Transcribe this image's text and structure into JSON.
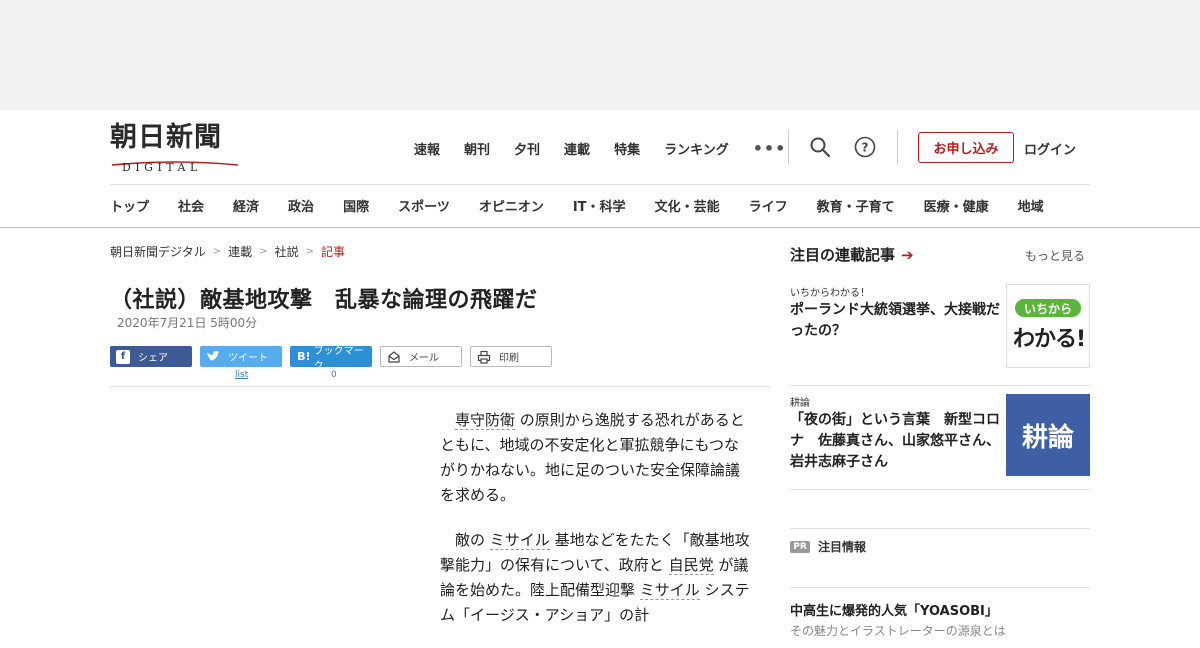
{
  "header": {
    "logo_kanji": "朝日新聞",
    "logo_sub": "DIGITAL",
    "top_nav": [
      "速報",
      "朝刊",
      "夕刊",
      "連載",
      "特集",
      "ランキング"
    ],
    "more_icon": "ellipsis-icon",
    "search_icon": "search-icon",
    "help_icon": "help-icon",
    "apply_label": "お申し込み",
    "login_label": "ログイン",
    "category_nav": [
      "トップ",
      "社会",
      "経済",
      "政治",
      "国際",
      "スポーツ",
      "オピニオン",
      "IT・科学",
      "文化・芸能",
      "ライフ",
      "教育・子育て",
      "医療・健康",
      "地域"
    ]
  },
  "breadcrumb": [
    "朝日新聞デジタル",
    "連載",
    "社説",
    "記事"
  ],
  "article": {
    "title": "（社説）敵基地攻撃　乱暴な論理の飛躍だ",
    "date": "2020年7月21日 5時00分",
    "share": {
      "facebook": "シェア",
      "twitter": "ツイート",
      "twitter_count": "list",
      "hatena": "ブックマーク",
      "hatena_count": "0",
      "mail": "メール",
      "print": "印刷"
    },
    "p1_kw": "専守防衛",
    "p1_text": "の原則から逸脱する恐れがあるとともに、地域の不安定化と軍拡競争にもつながりかねない。地に足のついた安全保障論議を求める。",
    "p2_a": "敵の",
    "p2_kw1": "ミサイル",
    "p2_b": "基地などをたたく「敵基地攻撃能力」の保有について、政府と",
    "p2_kw2": "自民党",
    "p2_c": "が議論を始めた。陸上配備型迎撃",
    "p2_kw3": "ミサイル",
    "p2_d": "システム「イージス・アショア」の計"
  },
  "sidebar": {
    "heading": "注目の連載記事",
    "more": "もっと見る",
    "cards": [
      {
        "kicker": "いちからわかる！",
        "headline": "ポーランド大統領選挙、大接戦だったの？",
        "thumb_top": "いちから",
        "thumb_main": "わかる!"
      },
      {
        "kicker": "耕論",
        "headline": "「夜の街」という言葉　新型コロナ　佐藤真さん、山家悠平さん、岩井志麻子さん",
        "thumb_main": "耕論"
      }
    ],
    "pr_badge": "PR",
    "pr_label": "注目情報",
    "pr_headline": "中高生に爆発的人気「YOASOBI」",
    "pr_sub": "その魅力とイラストレーターの源泉とは"
  },
  "colors": {
    "brand_red": "#b41e1e",
    "facebook": "#3b5a96",
    "twitter": "#55acee",
    "hatena": "#2d8fd5",
    "kouron_blue": "#3e5fa6"
  }
}
